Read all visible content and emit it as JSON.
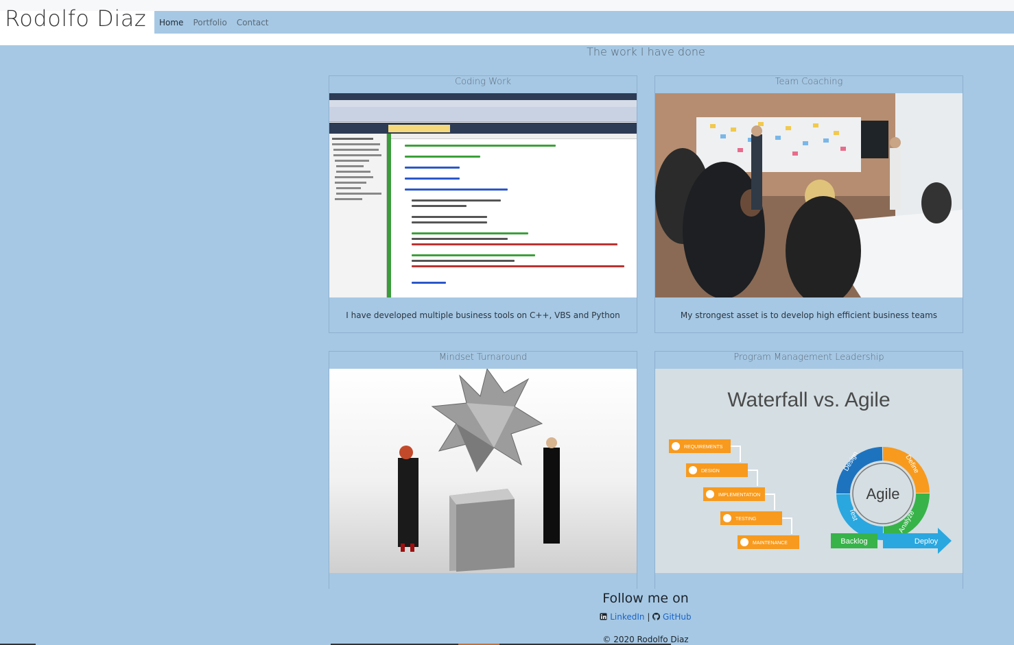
{
  "brand": "Rodolfo Diaz",
  "nav": [
    {
      "label": "Home"
    },
    {
      "label": "Portfolio"
    },
    {
      "label": "Contact"
    }
  ],
  "section_title": "The work I have done",
  "cards": [
    {
      "title": "Coding Work",
      "text": "I have developed multiple business tools on C++, VBS and Python"
    },
    {
      "title": "Team Coaching",
      "text": "My strongest asset is to develop high efficient business teams"
    },
    {
      "title": "Mindset Turnaround",
      "text": ""
    },
    {
      "title": "Program Management Leadership",
      "text": ""
    }
  ],
  "waterfall": {
    "heading": "Waterfall vs. Agile",
    "steps": [
      "REQUIREMENTS",
      "DESIGN",
      "IMPLEMENTATION",
      "TESTING",
      "MAINTENANCE"
    ],
    "agile_center": "Agile",
    "agile_labels": [
      "Design",
      "Define",
      "Analyze",
      "Test"
    ],
    "backlog": "Backlog",
    "deploy": "Deploy"
  },
  "footer": {
    "follow": "Follow me on",
    "linkedin": "LinkedIn",
    "separator": "|",
    "github": "GitHub",
    "copyright": "© 2020 Rodolfo Diaz"
  },
  "colors": {
    "page_bg": "#a6c8e4",
    "link": "#1a63c7",
    "wf_orange": "#f79a1e",
    "agile_blue": "#1e73be",
    "agile_green": "#37b34a",
    "agile_cyan": "#2aa7df"
  }
}
